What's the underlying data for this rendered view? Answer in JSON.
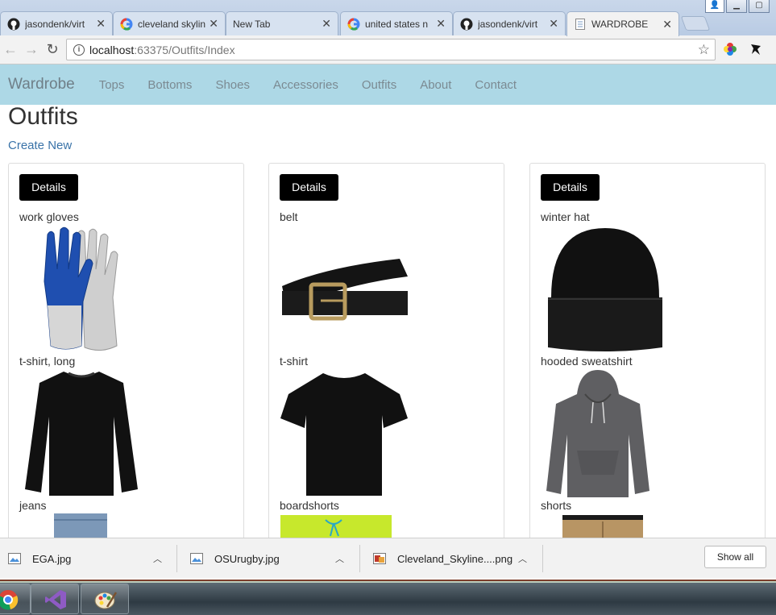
{
  "browser": {
    "tabs": [
      {
        "title": "jasondenk/virt",
        "icon": "github-icon"
      },
      {
        "title": "cleveland skylin",
        "icon": "google-icon"
      },
      {
        "title": "New Tab",
        "icon": ""
      },
      {
        "title": "united states n",
        "icon": "google-icon"
      },
      {
        "title": "jasondenk/virt",
        "icon": "github-icon"
      },
      {
        "title": "WARDROBE",
        "icon": "page-icon"
      }
    ],
    "url_host": "localhost",
    "url_path": ":63375/Outfits/Index"
  },
  "site": {
    "brand": "Wardrobe",
    "nav": [
      "Tops",
      "Bottoms",
      "Shoes",
      "Accessories",
      "Outfits",
      "About",
      "Contact"
    ]
  },
  "page": {
    "title": "Outfits",
    "create_new": "Create New",
    "details_label": "Details",
    "outfits": [
      {
        "items": [
          "work gloves",
          "t-shirt, long",
          "jeans"
        ]
      },
      {
        "items": [
          "belt",
          "t-shirt",
          "boardshorts"
        ]
      },
      {
        "items": [
          "winter hat",
          "hooded sweatshirt",
          "shorts"
        ]
      }
    ]
  },
  "downloads": {
    "files": [
      "EGA.jpg",
      "OSUrugby.jpg",
      "Cleveland_Skyline....png"
    ],
    "show_all": "Show all"
  },
  "colors": {
    "navbar": "#add8e6",
    "link": "#3a73a8",
    "button": "#000000"
  }
}
